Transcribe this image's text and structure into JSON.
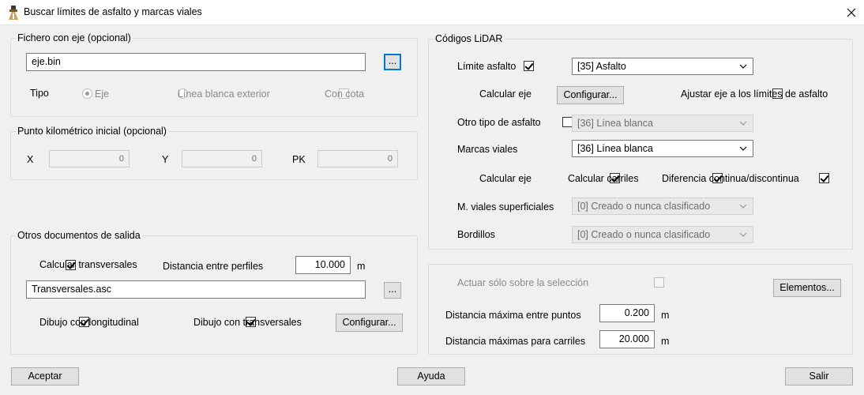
{
  "window": {
    "title": "Buscar límites de asfalto y marcas viales",
    "icon": "app-icon",
    "close": "close-icon"
  },
  "fichero": {
    "legend": "Fichero con eje (opcional)",
    "file_value": "eje.bin",
    "browse_label": "...",
    "tipo_label": "Tipo",
    "radio_eje": "Eje",
    "radio_linea": "Línea blanca exterior",
    "con_cota": "Con cota"
  },
  "punto": {
    "legend": "Punto kilométrico inicial (opcional)",
    "x_label": "X",
    "x_value": "0",
    "y_label": "Y",
    "y_value": "0",
    "pk_label": "PK",
    "pk_value": "0"
  },
  "otros": {
    "legend": "Otros documentos de salida",
    "calcular_transversales": "Calcular transversales",
    "distancia_label": "Distancia entre perfiles",
    "distancia_value": "10.000",
    "distancia_unit": "m",
    "trans_file": "Transversales.asc",
    "browse_label": "...",
    "dibujo_longitudinal": "Dibujo con longitudinal",
    "dibujo_transversales": "Dibujo con transversales",
    "configurar": "Configurar..."
  },
  "lidar": {
    "legend": "Códigos LiDAR",
    "limite_asfalto": "Límite asfalto",
    "limite_asfalto_value": "[35] Asfalto",
    "calcular_eje": "Calcular eje",
    "configurar": "Configurar...",
    "ajustar_eje": "Ajustar eje a los límites de asfalto",
    "otro_tipo": "Otro tipo de asfalto",
    "otro_tipo_value": "[36] Línea blanca",
    "marcas_viales": "Marcas viales",
    "marcas_viales_value": "[36] Línea blanca",
    "calcular_eje2": "Calcular eje",
    "calcular_carriles": "Calcular carriles",
    "diferencia": "Diferencia continua/discontinua",
    "m_viales_sup": "M. viales superficiales",
    "m_viales_sup_value": "[0] Creado o nunca clasificado",
    "bordillos": "Bordillos",
    "bordillos_value": "[0] Creado o nunca clasificado"
  },
  "accion": {
    "actuar": "Actuar sólo sobre la selección",
    "elementos": "Elementos...",
    "dist_max_puntos_label": "Distancia máxima entre puntos",
    "dist_max_puntos_value": "0.200",
    "dist_max_puntos_unit": "m",
    "dist_max_carriles_label": "Distancia máximas para carriles",
    "dist_max_carriles_value": "20.000",
    "dist_max_carriles_unit": "m"
  },
  "footer": {
    "aceptar": "Aceptar",
    "ayuda": "Ayuda",
    "salir": "Salir"
  }
}
